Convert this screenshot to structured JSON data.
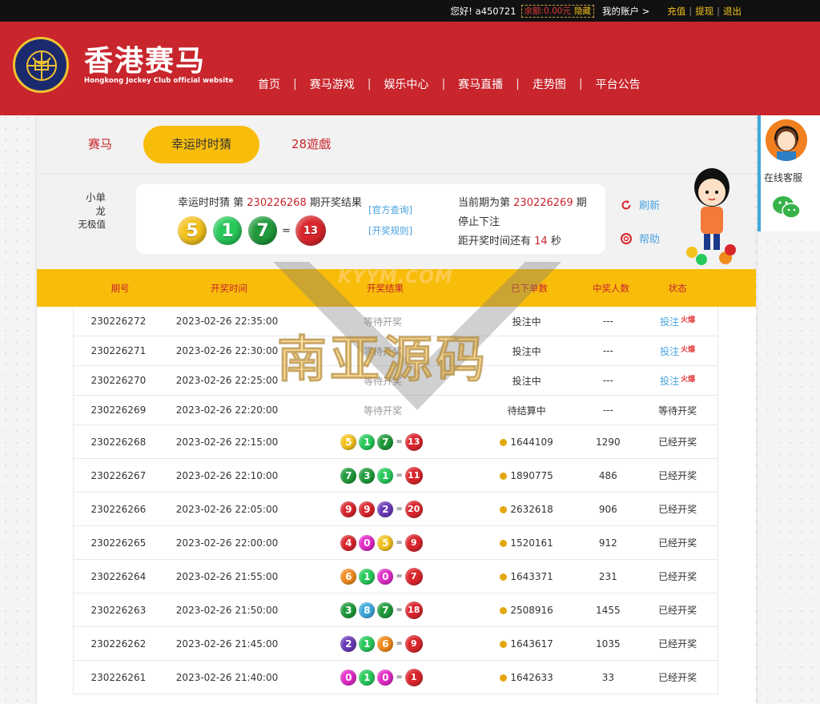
{
  "topbar": {
    "greeting": "您好! a450721",
    "balance_amount": "余额:0.00元",
    "balance_hide": "隐藏",
    "account": "我的账户 >",
    "links": [
      "充值",
      "提现",
      "退出"
    ]
  },
  "header": {
    "brand_cn": "香港赛马",
    "brand_en": "Hongkong Jockey Club official website",
    "nav": [
      "首页",
      "赛马游戏",
      "娱乐中心",
      "赛马直播",
      "走势图",
      "平台公告"
    ]
  },
  "tabs": [
    "赛马",
    "幸运时时猜",
    "28遊戲"
  ],
  "info": {
    "attrs": [
      "小单",
      "龙",
      "无极值"
    ],
    "result_prefix": "幸运时时猜 第",
    "result_period": "230226268",
    "result_suffix": "期开奖结果",
    "balls": [
      {
        "n": "5",
        "color": "#f4c21d"
      },
      {
        "n": "1",
        "color": "#27c95a"
      },
      {
        "n": "7",
        "color": "#1f9a3b"
      }
    ],
    "sum": "13",
    "sum_color": "#d9262c",
    "eq": "=",
    "link_official": "[官方查询]",
    "link_rules": "[开奖规则]",
    "current_prefix": "当前期为第",
    "current_period": "230226269",
    "current_suffix": "期",
    "status": "停止下注",
    "countdown_prefix": "距开奖时间还有",
    "countdown_value": "14",
    "countdown_suffix": "秒",
    "refresh": "刷新",
    "help": "帮助"
  },
  "table": {
    "headers": [
      "期号",
      "开奖时间",
      "开奖结果",
      "已下单数",
      "中奖人数",
      "状态"
    ],
    "rows": [
      {
        "p": "230226272",
        "t": "2023-02-26 22:35:00",
        "res": "等待开奖",
        "orders": "投注中",
        "winners": "---",
        "status": "投注",
        "fire": true
      },
      {
        "p": "230226271",
        "t": "2023-02-26 22:30:00",
        "res": "等待开奖",
        "orders": "投注中",
        "winners": "---",
        "status": "投注",
        "fire": true
      },
      {
        "p": "230226270",
        "t": "2023-02-26 22:25:00",
        "res": "等待开奖",
        "orders": "投注中",
        "winners": "---",
        "status": "投注",
        "fire": true
      },
      {
        "p": "230226269",
        "t": "2023-02-26 22:20:00",
        "res": "等待开奖",
        "orders": "待结算中",
        "winners": "---",
        "status": "等待开奖",
        "fire": false
      },
      {
        "p": "230226268",
        "t": "2023-02-26 22:15:00",
        "balls": [
          "5",
          "1",
          "7"
        ],
        "colors": [
          "#f4c21d",
          "#27c95a",
          "#1f9a3b"
        ],
        "sum": "13",
        "orders": "1644109",
        "winners": "1290",
        "status": "已经开奖"
      },
      {
        "p": "230226267",
        "t": "2023-02-26 22:10:00",
        "balls": [
          "7",
          "3",
          "1"
        ],
        "colors": [
          "#1f9a3b",
          "#1f9a3b",
          "#27c95a"
        ],
        "sum": "11",
        "orders": "1890775",
        "winners": "486",
        "status": "已经开奖"
      },
      {
        "p": "230226266",
        "t": "2023-02-26 22:05:00",
        "balls": [
          "9",
          "9",
          "2"
        ],
        "colors": [
          "#d9262c",
          "#d9262c",
          "#6a3ab8"
        ],
        "sum": "20",
        "orders": "2632618",
        "winners": "906",
        "status": "已经开奖"
      },
      {
        "p": "230226265",
        "t": "2023-02-26 22:00:00",
        "balls": [
          "4",
          "0",
          "5"
        ],
        "colors": [
          "#d9262c",
          "#e229c7",
          "#f4c21d"
        ],
        "sum": "9",
        "orders": "1520161",
        "winners": "912",
        "status": "已经开奖"
      },
      {
        "p": "230226264",
        "t": "2023-02-26 21:55:00",
        "balls": [
          "6",
          "1",
          "0"
        ],
        "colors": [
          "#f08a1c",
          "#27c95a",
          "#e229c7"
        ],
        "sum": "7",
        "orders": "1643371",
        "winners": "231",
        "status": "已经开奖"
      },
      {
        "p": "230226263",
        "t": "2023-02-26 21:50:00",
        "balls": [
          "3",
          "8",
          "7"
        ],
        "colors": [
          "#1f9a3b",
          "#3ea8dc",
          "#1f9a3b"
        ],
        "sum": "18",
        "orders": "2508916",
        "winners": "1455",
        "status": "已经开奖"
      },
      {
        "p": "230226262",
        "t": "2023-02-26 21:45:00",
        "balls": [
          "2",
          "1",
          "6"
        ],
        "colors": [
          "#6a3ab8",
          "#27c95a",
          "#f08a1c"
        ],
        "sum": "9",
        "orders": "1643617",
        "winners": "1035",
        "status": "已经开奖"
      },
      {
        "p": "230226261",
        "t": "2023-02-26 21:40:00",
        "balls": [
          "0",
          "1",
          "0"
        ],
        "colors": [
          "#e229c7",
          "#27c95a",
          "#e229c7"
        ],
        "sum": "1",
        "orders": "1642633",
        "winners": "33",
        "status": "已经开奖"
      }
    ],
    "fire_text": "火爆"
  },
  "side": {
    "service_label": "在线客服"
  },
  "watermark": {
    "small": "KYYM.COM",
    "big": "南亚源码"
  }
}
